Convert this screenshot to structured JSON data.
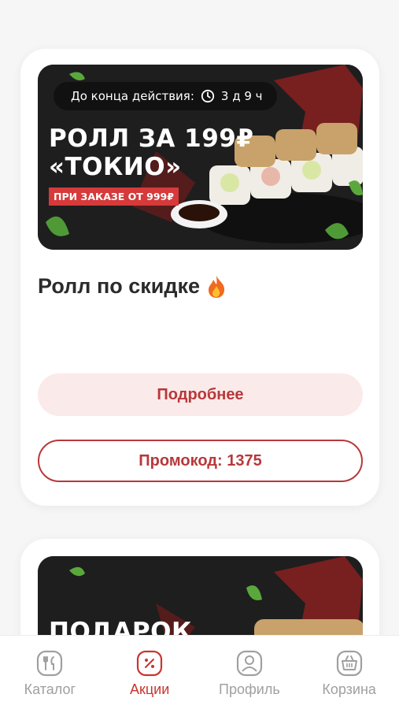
{
  "promos": [
    {
      "timer_label": "До конца действия:",
      "timer_value": "3 д 9 ч",
      "banner_title": "РОЛЛ ЗА 199₽\n«ТОКИО»",
      "banner_tag": "ПРИ ЗАКАЗЕ ОТ 999₽",
      "title": "Ролл по скидке",
      "details_label": "Подробнее",
      "promo_label": "Промокод: 1375"
    },
    {
      "banner_title": "ПОДАРОК"
    }
  ],
  "tabbar": {
    "items": [
      {
        "label": "Каталог",
        "icon": "catalog-icon"
      },
      {
        "label": "Акции",
        "icon": "promo-icon"
      },
      {
        "label": "Профиль",
        "icon": "profile-icon"
      },
      {
        "label": "Корзина",
        "icon": "cart-icon"
      }
    ],
    "active": "Акции"
  },
  "colors": {
    "accent": "#c8352f",
    "button_soft_bg": "#fbeaea",
    "banner_red": "#d63a3a",
    "inactive": "#a0a0a0"
  }
}
